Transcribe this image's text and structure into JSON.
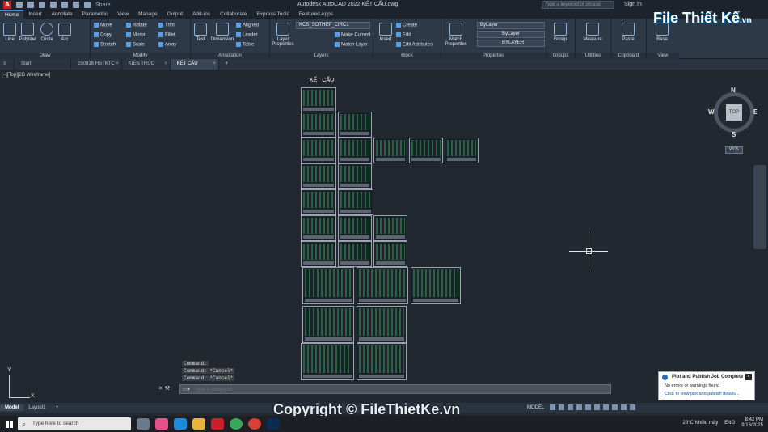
{
  "window": {
    "title": "Autodesk AutoCAD 2022    KẾT CẤU.dwg",
    "share_label": "Share",
    "search_placeholder": "Type a keyword or phrase",
    "sign_in": "Sign In"
  },
  "ribbon_tabs": [
    "Home",
    "Insert",
    "Annotate",
    "Parametric",
    "View",
    "Manage",
    "Output",
    "Add-ins",
    "Collaborate",
    "Express Tools",
    "Featured Apps"
  ],
  "ribbon": {
    "draw": {
      "label": "Draw",
      "tools": [
        "Line",
        "Polyline",
        "Circle",
        "Arc"
      ]
    },
    "modify": {
      "label": "Modify",
      "tools": [
        "Move",
        "Rotate",
        "Trim",
        "Copy",
        "Mirror",
        "Fillet",
        "Stretch",
        "Scale",
        "Array"
      ]
    },
    "annotation": {
      "label": "Annotation",
      "tools": [
        "Text",
        "Dimension",
        "Aligned",
        "Leader",
        "Table"
      ]
    },
    "layers": {
      "label": "Layers",
      "big": "Layer Properties",
      "current_layer": "KCS_SOTHEP_CIRC1",
      "tools": [
        "Make Current",
        "Match Layer"
      ]
    },
    "block": {
      "label": "Block",
      "big": "Insert",
      "tools": [
        "Create",
        "Edit",
        "Edit Attributes"
      ]
    },
    "properties": {
      "label": "Properties",
      "big": "Match Properties",
      "color": "ByLayer",
      "linetype": "ByLayer",
      "lineweight": "BYLAYER"
    },
    "groups": {
      "label": "Groups",
      "big": "Group"
    },
    "utilities": {
      "label": "Utilities",
      "big": "Measure"
    },
    "clipboard": {
      "label": "Clipboard",
      "big": "Paste"
    },
    "view": {
      "label": "View",
      "big": "Base"
    }
  },
  "file_tabs": [
    "Start",
    "250816 HSTKTC",
    "KIẾN TRÚC",
    "KẾT CẤU"
  ],
  "viewport": {
    "label": "[−][Top][2D Wireframe]",
    "drawing_title": "KẾT CẤU"
  },
  "viewcube": {
    "top": "TOP",
    "n": "N",
    "s": "S",
    "e": "E",
    "w": "W",
    "wcs": "WCS"
  },
  "ucs": {
    "x": "X",
    "y": "Y"
  },
  "command_history": [
    "Command:",
    "Command: *Cancel*",
    "Command: *Cancel*"
  ],
  "command_placeholder": "Type a command",
  "layout_tabs": [
    "Model",
    "Layout1"
  ],
  "status": {
    "model": "MODEL"
  },
  "watermark": "Copyright © FileThietKe.vn",
  "logo": {
    "text": "File Thiết Kế",
    "suffix": ".vn"
  },
  "notification": {
    "title": "Plot and Publish Job Complete",
    "message": "No errors or warnings found",
    "link": "Click to view plot and publish details..."
  },
  "taskbar": {
    "search_placeholder": "Type here to search",
    "weather": "28°C  Nhiều mây",
    "lang": "ENG",
    "time": "8:42 PM",
    "date": "9/16/2025"
  }
}
